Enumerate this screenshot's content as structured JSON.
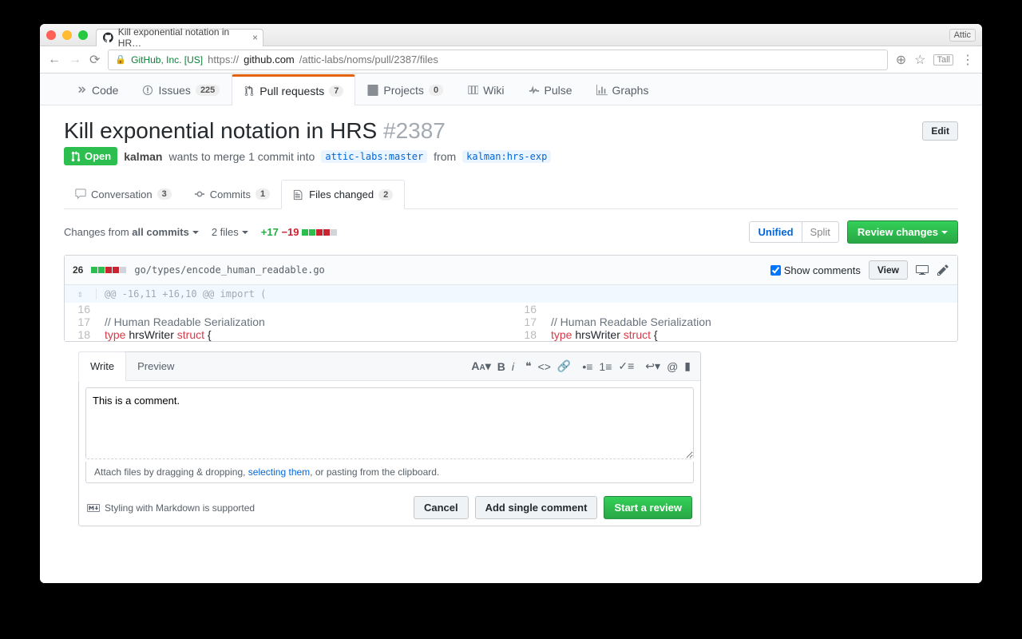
{
  "browser": {
    "tab_title": "Kill exponential notation in HR…",
    "ext_badge": "Attic",
    "ev_label": "GitHub, Inc. [US]",
    "url_scheme": "https://",
    "url_host": "github.com",
    "url_path": "/attic-labs/noms/pull/2387/files"
  },
  "reponav": {
    "code": "Code",
    "issues": "Issues",
    "issues_count": "225",
    "pr": "Pull requests",
    "pr_count": "7",
    "projects": "Projects",
    "projects_count": "0",
    "wiki": "Wiki",
    "pulse": "Pulse",
    "graphs": "Graphs"
  },
  "pr": {
    "title": "Kill exponential notation in HRS",
    "number": "#2387",
    "edit": "Edit",
    "state": "Open",
    "author": "kalman",
    "wants": "wants to merge 1 commit into",
    "base_branch": "attic-labs:master",
    "from": "from",
    "head_branch": "kalman:hrs-exp"
  },
  "prnav": {
    "conversation": "Conversation",
    "conv_count": "3",
    "commits": "Commits",
    "commits_count": "1",
    "files": "Files changed",
    "files_count": "2"
  },
  "toolbar": {
    "changes_from": "Changes from",
    "all_commits": "all commits",
    "file_count": "2 files",
    "additions": "+17",
    "deletions": "−19",
    "unified": "Unified",
    "split": "Split",
    "review": "Review changes"
  },
  "file": {
    "changes": "26",
    "path": "go/types/encode_human_readable.go",
    "show_comments": "Show comments",
    "view": "View",
    "hunk": "@@ -16,11 +16,10 @@ import (",
    "rows": [
      {
        "l": "16",
        "r": "16",
        "text": ""
      },
      {
        "l": "17",
        "r": "17",
        "text": "// Human Readable Serialization",
        "comment": true
      },
      {
        "l": "18",
        "r": "18",
        "text": "type hrsWriter struct {",
        "code": true
      }
    ]
  },
  "comment": {
    "write": "Write",
    "preview": "Preview",
    "text": "This is a comment.",
    "attach_pre": "Attach files by dragging & dropping, ",
    "attach_link": "selecting them",
    "attach_post": ", or pasting from the clipboard.",
    "md": "Styling with Markdown is supported",
    "cancel": "Cancel",
    "single": "Add single comment",
    "start": "Start a review"
  }
}
